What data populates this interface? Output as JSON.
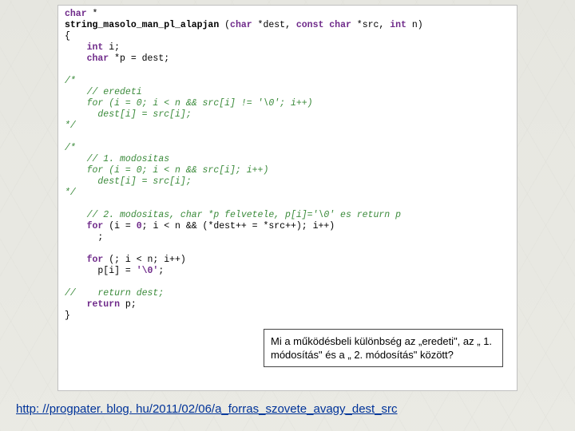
{
  "code": {
    "l01a": "char",
    "l01b": " *",
    "l02a": "string_masolo_man_pl_alapjan",
    "l02b": " (",
    "l02c": "char",
    "l02d": " *dest, ",
    "l02e": "const char",
    "l02f": " *src, ",
    "l02g": "int",
    "l02h": " n)",
    "l03": "{",
    "l04a": "    int",
    "l04b": " i;",
    "l05a": "    char",
    "l05b": " *p = dest;",
    "l06": "",
    "l07": "/*",
    "l08": "    // eredeti",
    "l09": "    for (i = 0; i < n && src[i] != '\\0'; i++)",
    "l10": "      dest[i] = src[i];",
    "l11": "*/",
    "l12": "",
    "l13": "/*",
    "l14": "    // 1. modositas",
    "l15": "    for (i = 0; i < n && src[i]; i++)",
    "l16": "      dest[i] = src[i];",
    "l17": "*/",
    "l18": "",
    "l19": "    // 2. modositas, char *p felvetele, p[i]='\\0' es return p",
    "l20a": "    for",
    "l20b": " (i = ",
    "l20c": "0",
    "l20d": "; i < n && (*dest++ = *src++); i++)",
    "l21": "      ;",
    "l22": "",
    "l23a": "    for",
    "l23b": " (; i < n; i++)",
    "l24a": "      p[i] = ",
    "l24b": "'\\0'",
    "l24c": ";",
    "l25": "",
    "l26": "//    return dest;",
    "l27a": "    return",
    "l27b": " p;",
    "l28": "}"
  },
  "question": "Mi a működésbeli különbség az „eredeti\", az „ 1. módosítás\" és a „ 2. módosítás\" között?",
  "link": "http: //progpater. blog. hu/2011/02/06/a_forras_szovete_avagy_dest_src"
}
